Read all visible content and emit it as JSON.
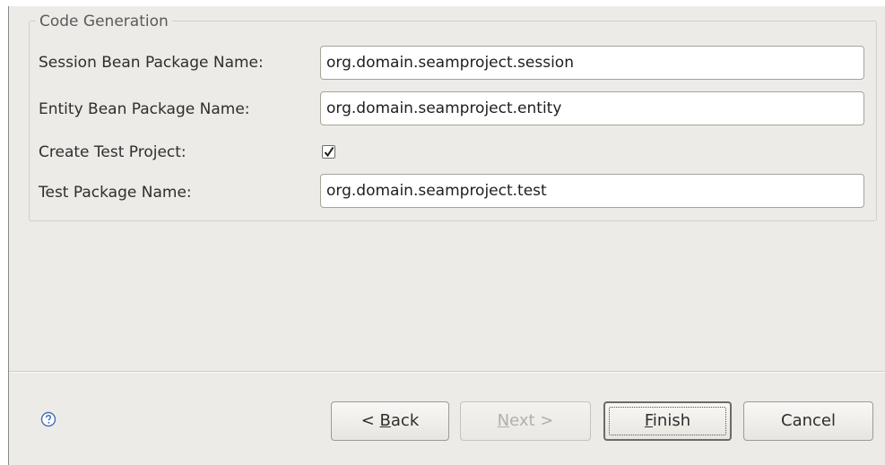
{
  "code_generation": {
    "group_title": "Code Generation",
    "session_bean": {
      "label": "Session Bean Package Name:",
      "value": "org.domain.seamproject.session"
    },
    "entity_bean": {
      "label": "Entity Bean Package Name:",
      "value": "org.domain.seamproject.entity"
    },
    "create_test_project": {
      "label": "Create Test Project:",
      "checked": true
    },
    "test_package": {
      "label": "Test Package Name:",
      "value": "org.domain.seamproject.test"
    }
  },
  "buttons": {
    "back": {
      "prefix": "< ",
      "mnemonic": "B",
      "rest": "ack",
      "enabled": true
    },
    "next": {
      "mnemonic": "N",
      "rest": "ext >",
      "enabled": false
    },
    "finish": {
      "mnemonic": "F",
      "rest": "inish",
      "enabled": true,
      "default": true
    },
    "cancel": {
      "label": "Cancel",
      "enabled": true
    }
  },
  "icons": {
    "help": "help-icon",
    "check": "checkmark-icon"
  },
  "colors": {
    "dialog_bg": "#edebe7",
    "help_icon": "#3f6fb5"
  }
}
